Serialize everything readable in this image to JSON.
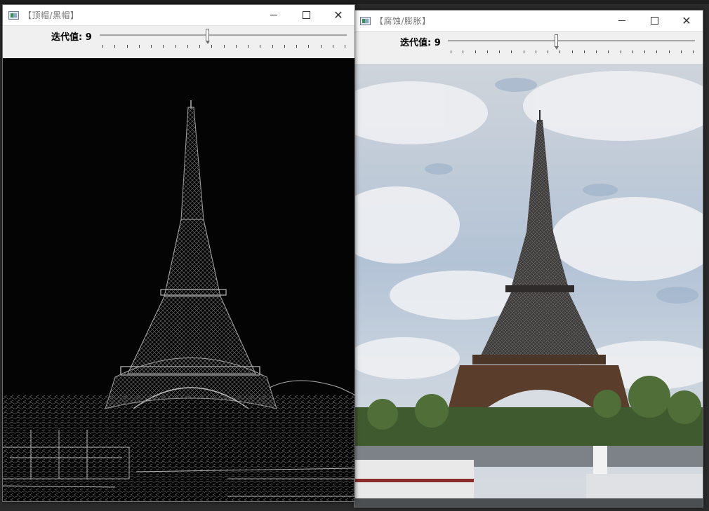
{
  "windows": [
    {
      "title": "【顶帽/黑帽】",
      "trackbar": {
        "label": "迭代值: 9",
        "value": 9,
        "max": 20
      }
    },
    {
      "title": "【腐蚀/膨胀】",
      "trackbar": {
        "label": "迭代值: 9",
        "value": 9,
        "max": 20
      }
    }
  ],
  "caption_buttons": {
    "minimize": "minimize-icon",
    "maximize": "maximize-icon",
    "close": "✕"
  },
  "icons": {
    "app": "opencv-window-icon"
  },
  "colors": {
    "title_text": "#777777",
    "toolbar_bg": "#f0f0f0",
    "sky": "#c4ccd6",
    "tophat_bg": "#050505"
  }
}
